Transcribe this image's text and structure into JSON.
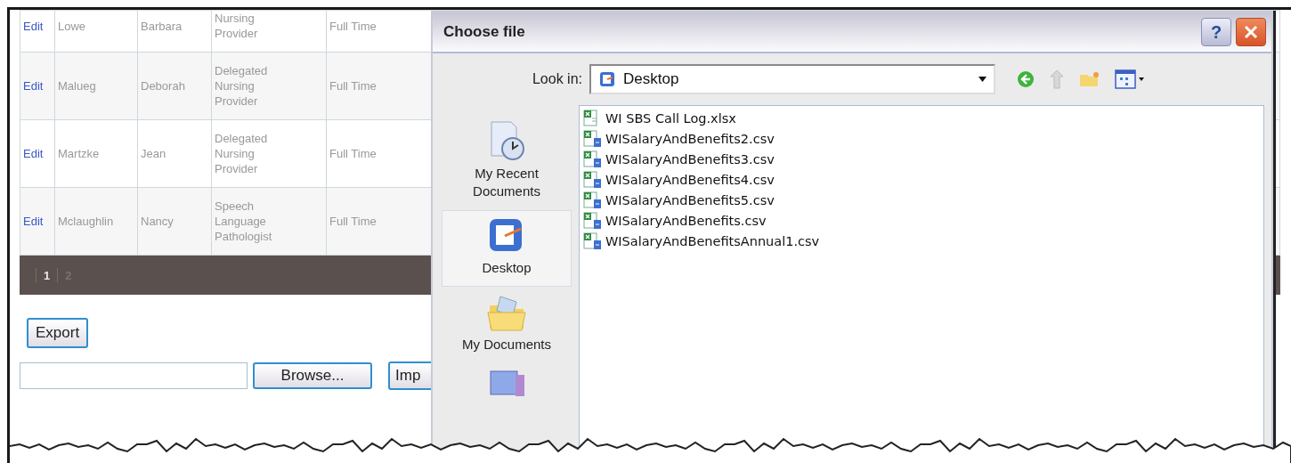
{
  "table": {
    "rows": [
      {
        "action": "Edit",
        "last_name": "Lowe",
        "first_name": "Barbara",
        "title": "Nursing Provider",
        "status": "Full Time"
      },
      {
        "action": "Edit",
        "last_name": "Malueg",
        "first_name": "Deborah",
        "title": "Delegated Nursing Provider",
        "status": "Full Time"
      },
      {
        "action": "Edit",
        "last_name": "Martzke",
        "first_name": "Jean",
        "title": "Delegated Nursing Provider",
        "status": "Full Time"
      },
      {
        "action": "Edit",
        "last_name": "Mclaughlin",
        "first_name": "Nancy",
        "title": "Speech Language Pathologist",
        "status": "Full Time"
      }
    ]
  },
  "pager": {
    "pages": [
      {
        "label": "1",
        "selected": true
      },
      {
        "label": "2",
        "selected": false
      }
    ]
  },
  "export_button": "Export",
  "upload": {
    "browse_button": "Browse...",
    "import_button": "Imp"
  },
  "dialog": {
    "title": "Choose file",
    "help_button": "?",
    "look_in": {
      "label": "Look in:",
      "value": "Desktop"
    },
    "places": [
      {
        "kind": "recent",
        "label": "My Recent Documents",
        "selected": false
      },
      {
        "kind": "desktop",
        "label": "Desktop",
        "selected": true
      },
      {
        "kind": "documents",
        "label": "My Documents",
        "selected": false
      },
      {
        "kind": "computer",
        "selected": false
      }
    ],
    "files": [
      {
        "kind": "xlsx",
        "name": "WI SBS Call Log.xlsx"
      },
      {
        "kind": "csv",
        "name": "WISalaryAndBenefits2.csv"
      },
      {
        "kind": "csv",
        "name": "WISalaryAndBenefits3.csv"
      },
      {
        "kind": "csv",
        "name": "WISalaryAndBenefits4.csv"
      },
      {
        "kind": "csv",
        "name": "WISalaryAndBenefits5.csv"
      },
      {
        "kind": "csv",
        "name": "WISalaryAndBenefits.csv"
      },
      {
        "kind": "csv",
        "name": "WISalaryAndBenefitsAnnual1.csv"
      }
    ]
  }
}
